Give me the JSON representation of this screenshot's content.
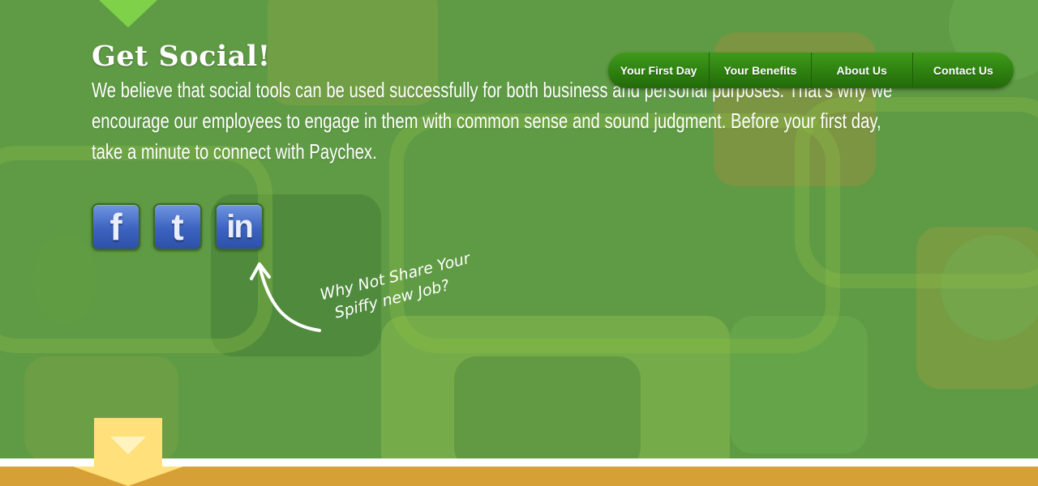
{
  "header": {
    "title": "Get Social!",
    "paragraph": "We believe that social tools can be used successfully for both business and personal purposes. That's why we encourage our employees to engage in them with common sense and sound judgment. Before your first day, take a minute to connect with Paychex."
  },
  "nav": {
    "items": [
      {
        "label": "Your First Day"
      },
      {
        "label": "Your Benefits"
      },
      {
        "label": "About Us"
      },
      {
        "label": "Contact Us"
      }
    ]
  },
  "social": {
    "facebook": {
      "icon": "facebook-icon",
      "glyph": "f"
    },
    "twitter": {
      "icon": "twitter-icon",
      "glyph": "t"
    },
    "linkedin": {
      "icon": "linkedin-icon",
      "glyph": "in"
    }
  },
  "callout": {
    "line1": "Why Not Share Your",
    "line2": "Spiffy new Job?"
  },
  "colors": {
    "background": "#5f9a45",
    "nav_green": "#2c7d0f",
    "social_blue": "#3c63c0",
    "accent_yellow": "#ffe07a",
    "band_orange": "#d6a037"
  }
}
